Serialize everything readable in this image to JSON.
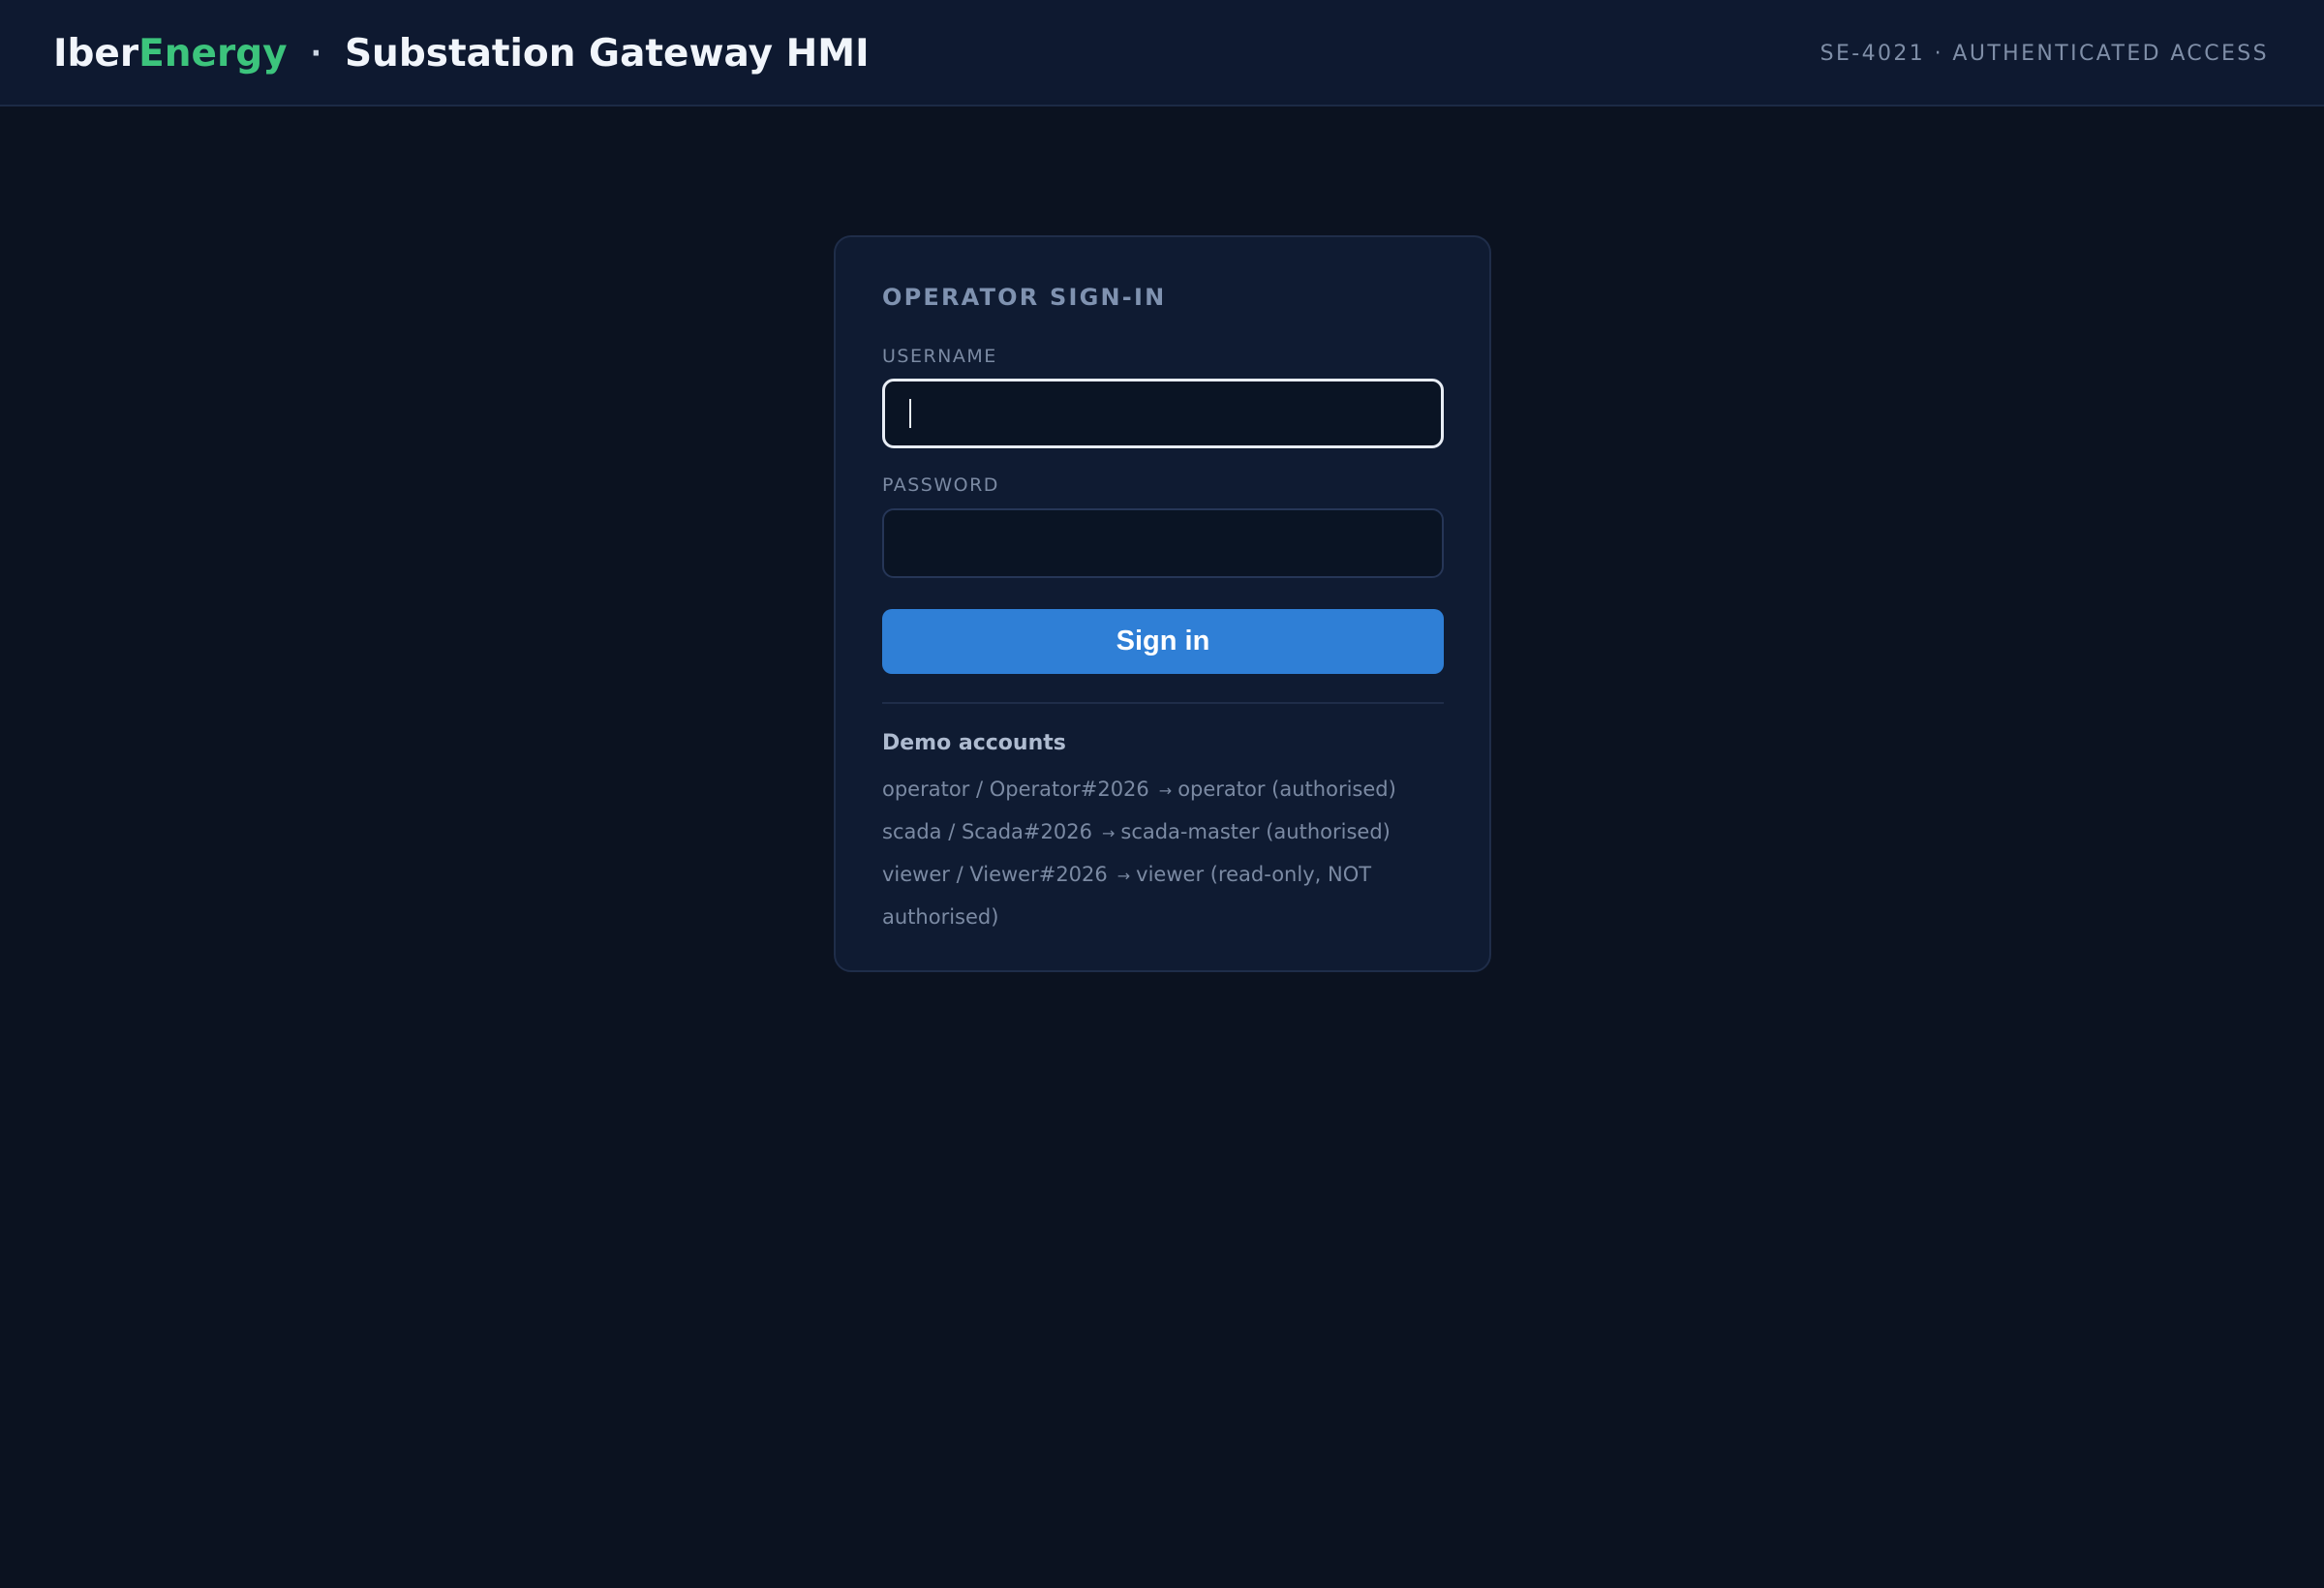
{
  "header": {
    "brand_part1": "Iber",
    "brand_part2": "Energy",
    "separator": "·",
    "app_title": "Substation Gateway HMI",
    "status": "SE-4021 · AUTHENTICATED ACCESS"
  },
  "login": {
    "title": "OPERATOR SIGN-IN",
    "username_label": "USERNAME",
    "username_value": "",
    "password_label": "PASSWORD",
    "password_value": "",
    "submit_label": "Sign in"
  },
  "demo": {
    "title": "Demo accounts",
    "arrow": "→",
    "accounts": [
      {
        "credentials": "operator / Operator#2026",
        "role": "operator (authorised)"
      },
      {
        "credentials": "scada / Scada#2026",
        "role": "scada-master (authorised)"
      },
      {
        "credentials": "viewer / Viewer#2026",
        "role": "viewer (read-only, NOT authorised)"
      }
    ]
  },
  "colors": {
    "background": "#0b1220",
    "accent_brand": "#3cc47c",
    "primary_button": "#2f7fd6"
  }
}
